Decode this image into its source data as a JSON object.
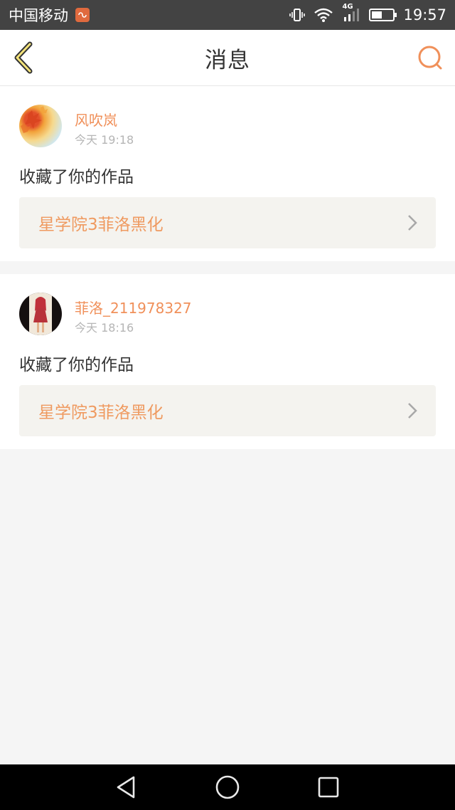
{
  "status_bar": {
    "carrier": "中国移动",
    "network": "4G",
    "time": "19:57",
    "battery_level": 0.55
  },
  "header": {
    "title": "消息",
    "back_icon": "chevron-left-icon",
    "search_icon": "search-icon",
    "accent_color": "#f0905a"
  },
  "messages": [
    {
      "username": "风吹岚",
      "time": "今天 19:18",
      "action": "收藏了你的作品",
      "work_title": "星学院3菲洛黑化"
    },
    {
      "username": "菲洛_211978327",
      "time": "今天 18:16",
      "action": "收藏了你的作品",
      "work_title": "星学院3菲洛黑化"
    }
  ],
  "nav_bar": {
    "back_icon": "triangle-back-icon",
    "home_icon": "circle-home-icon",
    "recent_icon": "square-recent-icon"
  }
}
